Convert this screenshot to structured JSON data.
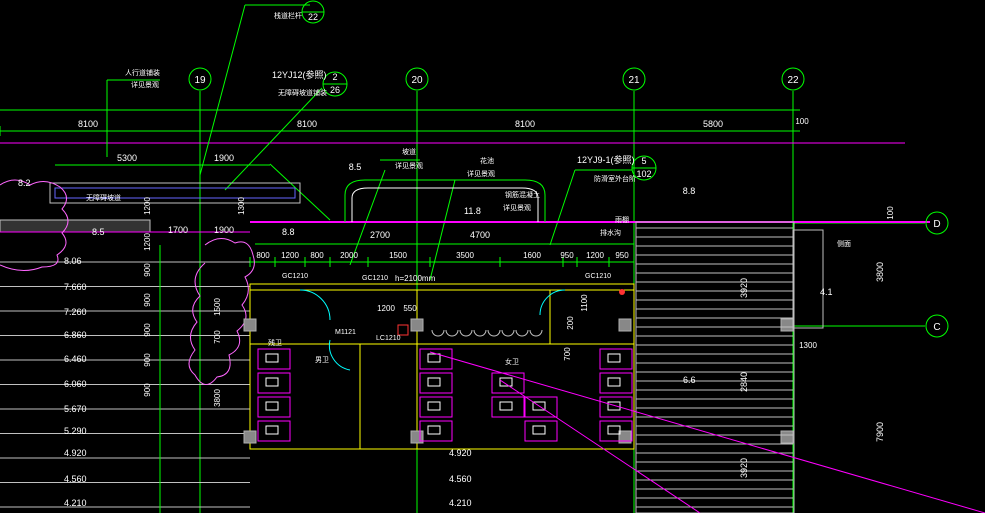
{
  "colors": {
    "background": "#000000",
    "dimension": "#00ff00",
    "wall": "#ffff00",
    "text": "#ffffff",
    "toilet": "#ff00ff",
    "pink": "#ff66cc",
    "cyan": "#00ffff",
    "column": "#b0b0b0",
    "stair": "#c0c0c0",
    "red": "#ff3333",
    "blue": "#6666ff"
  },
  "grid_axes": [
    {
      "id": "axis-19",
      "label": "19"
    },
    {
      "id": "axis-20",
      "label": "20"
    },
    {
      "id": "axis-21",
      "label": "21"
    },
    {
      "id": "axis-22",
      "label": "22"
    },
    {
      "id": "axis-d",
      "label": "D"
    },
    {
      "id": "axis-c",
      "label": "C"
    }
  ],
  "top_dimensions": [
    "8100",
    "8100",
    "8100",
    "5800",
    "100"
  ],
  "second_dimensions": [
    "5300",
    "1900",
    "8.5",
    "8.8"
  ],
  "sub_dimensions": [
    "800",
    "1200",
    "800",
    "2000",
    "1500",
    "3500",
    "1600",
    "950",
    "1200",
    "950"
  ],
  "mid_dimensions": [
    "1700",
    "1900",
    "2700",
    "4700"
  ],
  "vertical_dimensions_right": [
    "100",
    "3800",
    "7900",
    "3920",
    "2840",
    "3920"
  ],
  "vertical_dimensions_left": [
    "1200",
    "1200",
    "1300",
    "900",
    "1500",
    "700",
    "3800",
    "900",
    "900",
    "900",
    "900"
  ],
  "room_dimensions": [
    "1200",
    "550",
    "1100",
    "200",
    "700",
    "1300"
  ],
  "callouts": [
    {
      "id": "ref-22",
      "top": "22",
      "bottom": ""
    },
    {
      "id": "ref-2",
      "top": "2",
      "bottom": "26"
    },
    {
      "id": "ref-5",
      "top": "5",
      "bottom": "102"
    }
  ],
  "standard_refs": [
    "12YJ12(参照)",
    "12YJ9-1(参照)"
  ],
  "elevations": [
    "8.2",
    "8.5",
    "8.8",
    "11.8",
    "6.6",
    "4.1",
    "8.8"
  ],
  "stair_levels": [
    "8.06",
    "7.660",
    "7.260",
    "6.860",
    "6.460",
    "6.060",
    "5.670",
    "5.290",
    "4.920",
    "4.560",
    "4.210"
  ],
  "lower_levels": [
    "4.920",
    "4.560",
    "4.210"
  ],
  "door_window_tags": [
    "GC1210",
    "GC1210",
    "GC1210",
    "M1121",
    "LC1210"
  ],
  "clear_height": "h=2100mm",
  "cn_labels": [
    "人行道铺装",
    "详见景观",
    "无障碍坡道",
    "无障碍坡道铺装",
    "栈道栏杆",
    "坡道",
    "详见景观",
    "花池",
    "详见景观",
    "钢筋混凝土",
    "防滑室外台阶",
    "雨棚",
    "排水沟",
    "残卫",
    "男卫",
    "女卫",
    "详见景观",
    "侧面"
  ]
}
